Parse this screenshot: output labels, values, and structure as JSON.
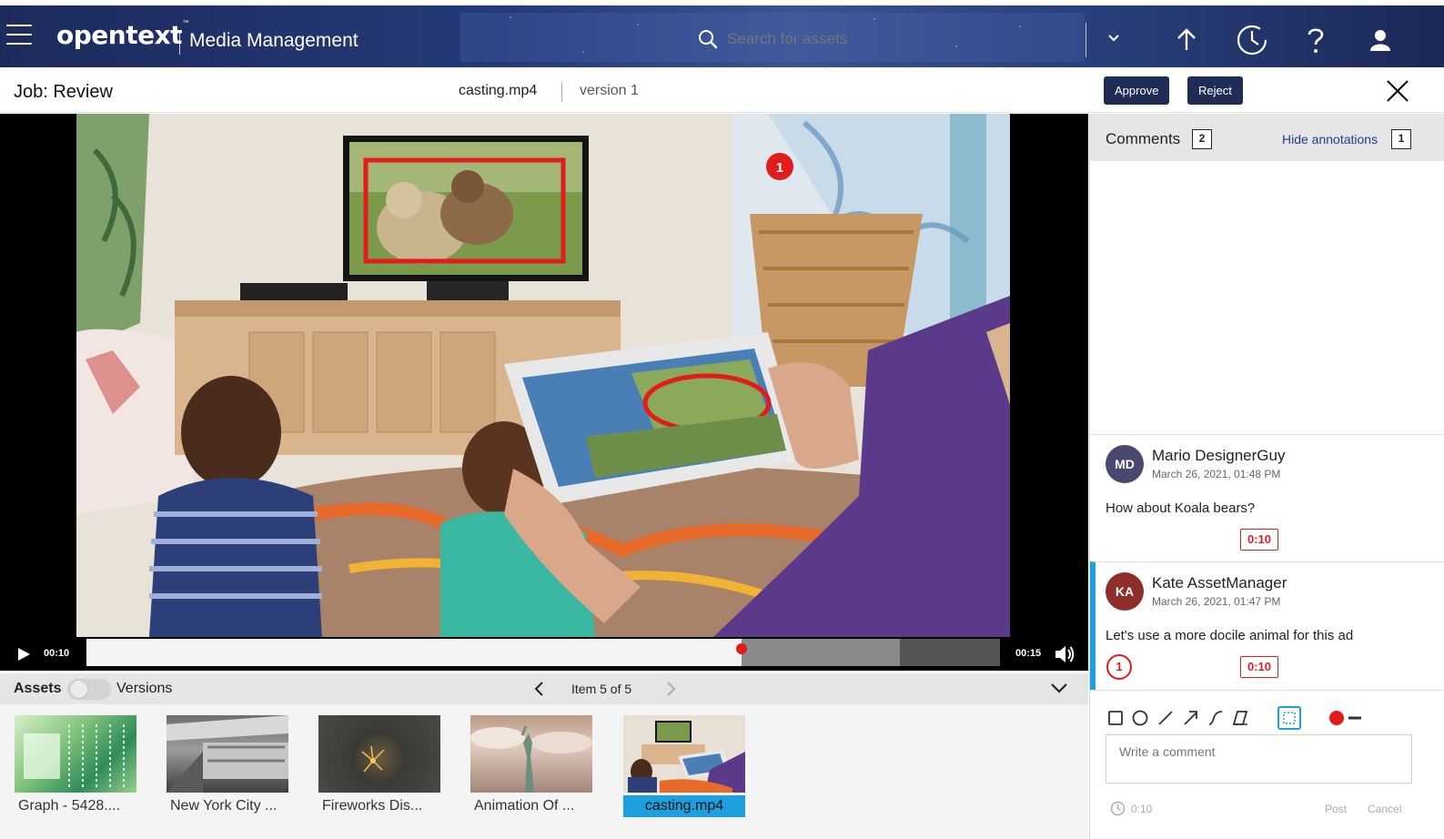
{
  "app": {
    "brand": "opentext",
    "brand_tm": "™",
    "product": "Media Management"
  },
  "search": {
    "placeholder": "Search for assets"
  },
  "top_icons": [
    "upload-icon",
    "clock-icon",
    "help-icon",
    "user-icon"
  ],
  "job": {
    "title": "Job: Review",
    "file_name": "casting.mp4",
    "version": "version 1",
    "approve_label": "Approve",
    "reject_label": "Reject"
  },
  "player": {
    "current_time": "00:10",
    "end_time": "00:15",
    "progress": 0.717,
    "buffered": 0.89,
    "annotation_marker": "1"
  },
  "assets": {
    "assets_label": "Assets",
    "versions_label": "Versions",
    "item_count": "Item 5 of 5",
    "items": [
      {
        "caption": "Graph - 5428...."
      },
      {
        "caption": "New York City ..."
      },
      {
        "caption": "Fireworks Dis..."
      },
      {
        "caption": "Animation Of ..."
      },
      {
        "caption": "casting.mp4"
      }
    ]
  },
  "comments": {
    "title": "Comments",
    "count": "2",
    "hide_label": "Hide annotations",
    "hide_count": "1",
    "items": [
      {
        "initials": "MD",
        "avatar_color": "#4a4870",
        "name": "Mario DesignerGuy",
        "date": "March 26, 2021, 01:48 PM",
        "text": "How about Koala bears?",
        "time": "0:10"
      },
      {
        "initials": "KA",
        "avatar_color": "#8e2f2a",
        "name": "Kate AssetManager",
        "date": "March 26, 2021, 01:47 PM",
        "text": "Let's use a more docile animal for this ad",
        "marker": "1",
        "time": "0:10"
      }
    ],
    "input_placeholder": "Write a comment",
    "footer_time": "0:10",
    "post_label": "Post",
    "cancel_label": "Cancel"
  },
  "colors": {
    "brand_dark": "#1f2d56",
    "accent_blue": "#1ea0e0",
    "annotation_red": "#e31b1b"
  }
}
